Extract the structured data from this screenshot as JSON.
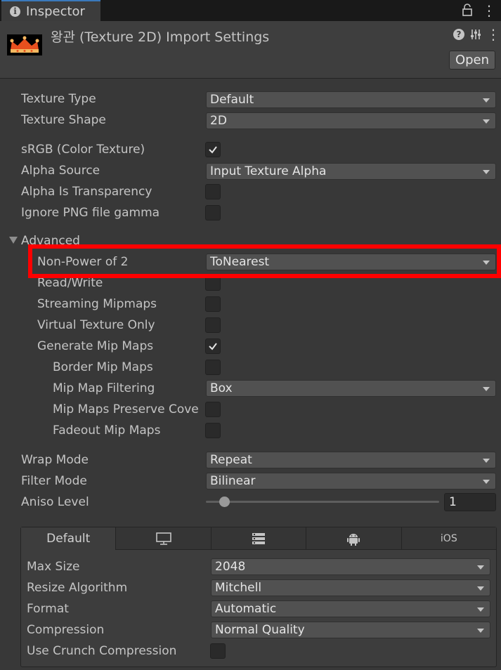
{
  "tab": {
    "title": "Inspector"
  },
  "header": {
    "title": "왕관 (Texture 2D) Import Settings",
    "open_label": "Open",
    "help_glyph": "?"
  },
  "properties": {
    "texture_type": {
      "label": "Texture Type",
      "value": "Default"
    },
    "texture_shape": {
      "label": "Texture Shape",
      "value": "2D"
    },
    "srgb": {
      "label": "sRGB (Color Texture)",
      "checked": true
    },
    "alpha_source": {
      "label": "Alpha Source",
      "value": "Input Texture Alpha"
    },
    "alpha_is_transparency": {
      "label": "Alpha Is Transparency",
      "checked": false
    },
    "ignore_png_gamma": {
      "label": "Ignore PNG file gamma",
      "checked": false
    }
  },
  "advanced": {
    "label": "Advanced",
    "non_power_of_2": {
      "label": "Non-Power of 2",
      "value": "ToNearest"
    },
    "read_write": {
      "label": "Read/Write",
      "checked": false
    },
    "streaming_mipmaps": {
      "label": "Streaming Mipmaps",
      "checked": false
    },
    "virtual_texture_only": {
      "label": "Virtual Texture Only",
      "checked": false
    },
    "generate_mip_maps": {
      "label": "Generate Mip Maps",
      "checked": true
    },
    "border_mip_maps": {
      "label": "Border Mip Maps",
      "checked": false
    },
    "mip_map_filtering": {
      "label": "Mip Map Filtering",
      "value": "Box"
    },
    "mip_maps_preserve_coverage": {
      "label": "Mip Maps Preserve Cove",
      "checked": false
    },
    "fadeout_mip_maps": {
      "label": "Fadeout Mip Maps",
      "checked": false
    }
  },
  "sampling": {
    "wrap_mode": {
      "label": "Wrap Mode",
      "value": "Repeat"
    },
    "filter_mode": {
      "label": "Filter Mode",
      "value": "Bilinear"
    },
    "aniso_level": {
      "label": "Aniso Level",
      "value": "1"
    }
  },
  "platform": {
    "tabs": [
      {
        "label": "Default",
        "icon": ""
      },
      {
        "label": "",
        "icon": "monitor-icon"
      },
      {
        "label": "",
        "icon": "server-icon"
      },
      {
        "label": "",
        "icon": "android-icon"
      },
      {
        "label": "iOS",
        "icon": ""
      }
    ],
    "max_size": {
      "label": "Max Size",
      "value": "2048"
    },
    "resize_algorithm": {
      "label": "Resize Algorithm",
      "value": "Mitchell"
    },
    "format": {
      "label": "Format",
      "value": "Automatic"
    },
    "compression": {
      "label": "Compression",
      "value": "Normal Quality"
    },
    "use_crunch": {
      "label": "Use Crunch Compression",
      "checked": false
    }
  },
  "colors": {
    "highlight": "#ff0000",
    "accent": "#3a79bb",
    "crown": "#e8501e"
  }
}
